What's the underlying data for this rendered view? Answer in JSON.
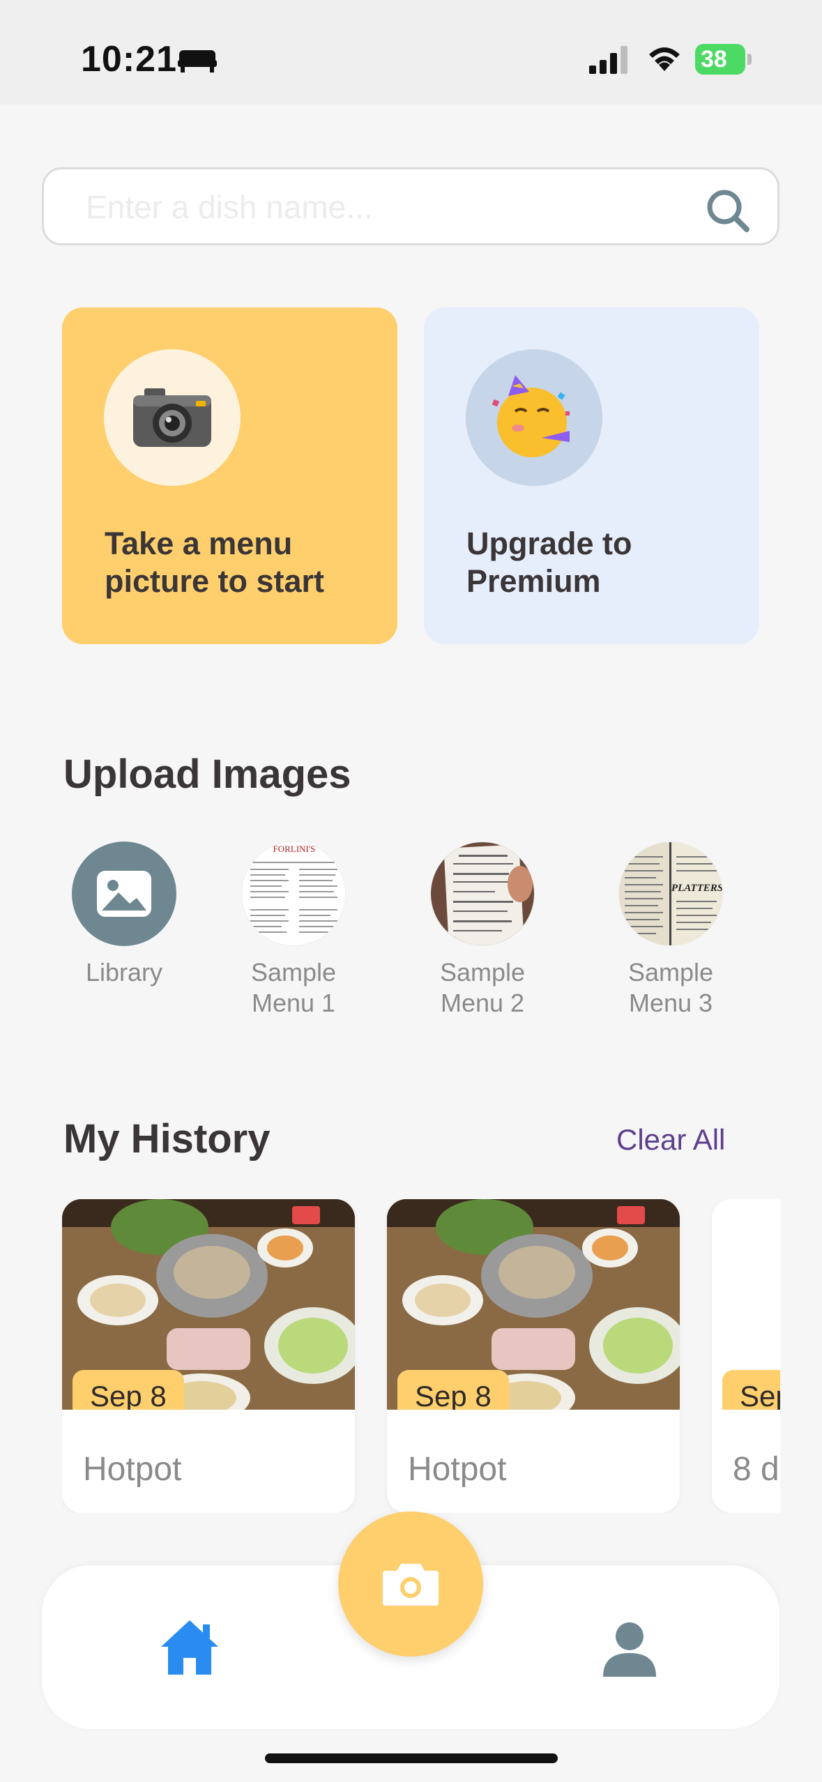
{
  "status_bar": {
    "time": "10:21",
    "battery": "38"
  },
  "search": {
    "placeholder": "Enter a dish name..."
  },
  "cards": {
    "menu_label": "Take a menu picture to start",
    "premium_label": "Upgrade to Premium"
  },
  "upload": {
    "title": "Upload Images",
    "items": [
      {
        "label": "Library"
      },
      {
        "label": "Sample Menu 1"
      },
      {
        "label": "Sample Menu 2"
      },
      {
        "label": "Sample Menu 3"
      }
    ],
    "menu1_header": "FORLINI'S",
    "menu3_header": "PLATTERS"
  },
  "history": {
    "title": "My History",
    "clear_label": "Clear All",
    "items": [
      {
        "date": "Sep 8",
        "name": "Hotpot"
      },
      {
        "date": "Sep 8",
        "name": "Hotpot"
      },
      {
        "date": "Sep",
        "name": "8 d"
      }
    ]
  },
  "colors": {
    "accent_yellow": "#fecf6c",
    "premium_bg": "#e6edfb",
    "clear_all": "#5d3f8e",
    "home_active": "#2a8cf0",
    "icon_gray": "#6e8791"
  },
  "icons": [
    "bed-icon",
    "signal-icon",
    "wifi-icon",
    "battery-icon",
    "search-icon",
    "camera-emoji-icon",
    "party-face-icon",
    "image-icon",
    "camera-icon",
    "home-icon",
    "profile-icon"
  ]
}
